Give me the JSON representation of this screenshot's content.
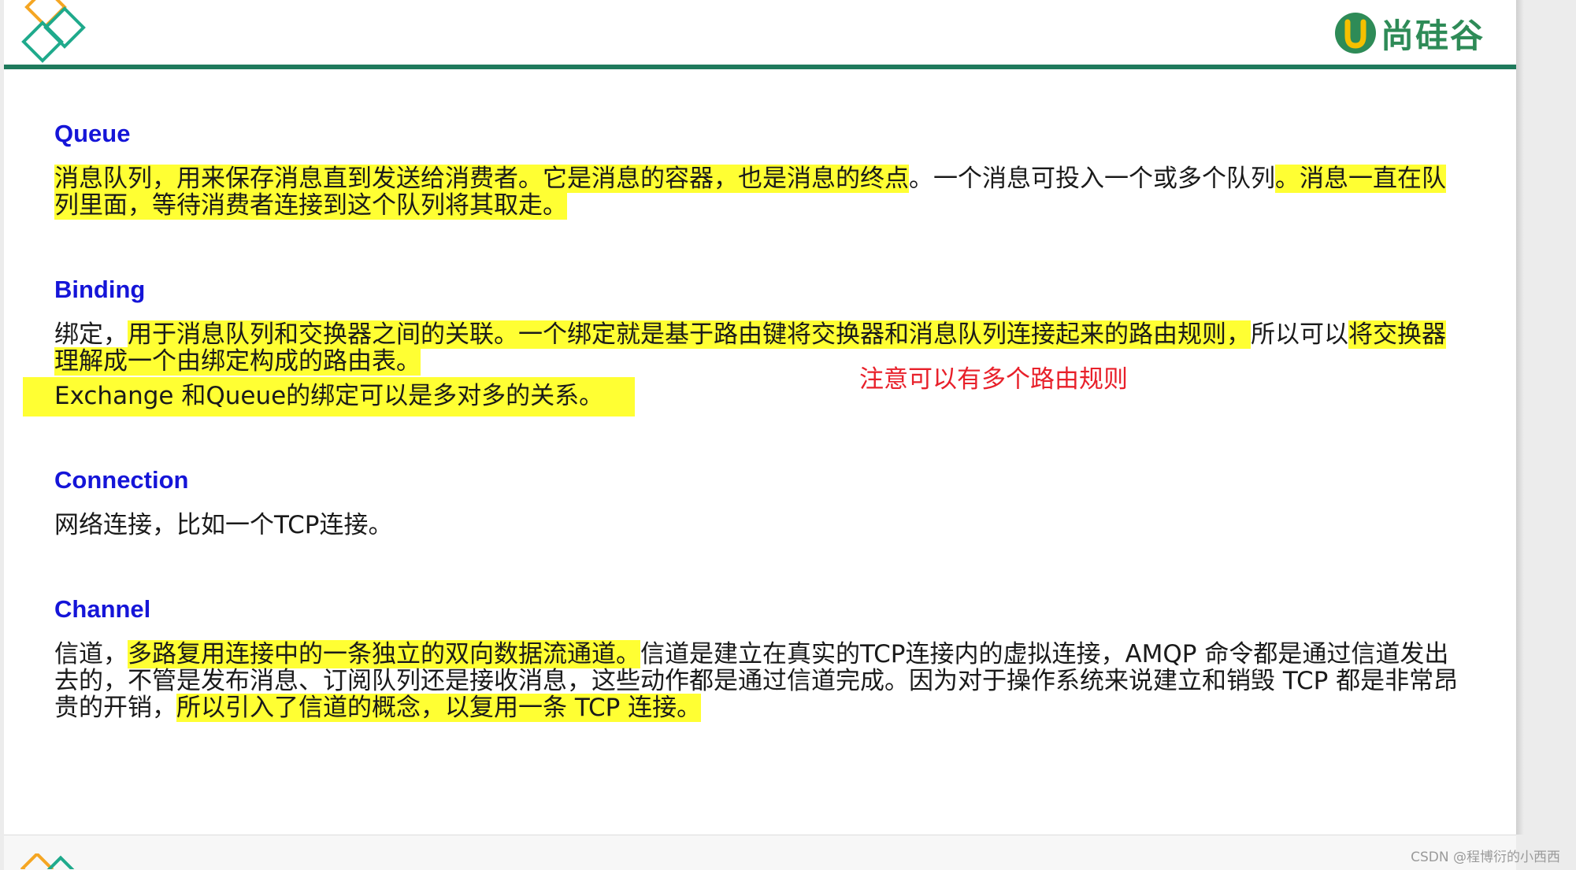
{
  "brand": {
    "name": "尚硅谷"
  },
  "sections": {
    "queue": {
      "heading": "Queue",
      "parts": [
        {
          "text": "消息队列，用来保存消息直到发送给消费者。它是消息的容器，也是消息的终点",
          "hl": true
        },
        {
          "text": "。一个消息可投入一个或多个队列",
          "hl": false
        },
        {
          "text": "。消息一直在队列里面，等待消费者连接到这个队列将其取走。",
          "hl": true
        }
      ]
    },
    "binding": {
      "heading": "Binding",
      "parts": [
        {
          "text": "绑定，",
          "hl": false
        },
        {
          "text": "用于消息队列和交换器之间的关联。一个绑定就是基于路由键将交换器和消息队列连接起来的路由规则，",
          "hl": true
        },
        {
          "text": "所以可以",
          "hl": false
        },
        {
          "text": "将交换器理解成一个由绑定构成的路由表。",
          "hl": true
        }
      ],
      "extra_line": "Exchange 和Queue的绑定可以是多对多的关系。",
      "note": "注意可以有多个路由规则"
    },
    "connection": {
      "heading": "Connection",
      "text": "网络连接，比如一个TCP连接。"
    },
    "channel": {
      "heading": "Channel",
      "parts": [
        {
          "text": "信道，",
          "hl": false
        },
        {
          "text": "多路复用连接中的一条独立的双向数据流通道。",
          "hl": true
        },
        {
          "text": "信道是建立在真实的TCP连接内的虚拟连接，AMQP 命令都是通过信道发出去的，不管是发布消息、订阅队列还是接收消息，这些动作都是通过信道完成。因为对于操作系统来说建立和销毁 TCP 都是非常昂贵的开销，",
          "hl": false
        },
        {
          "text": "所以引入了信道的概念，以复用一条 TCP 连接。",
          "hl": true
        }
      ]
    }
  },
  "watermark": "CSDN @程博衍的小西西",
  "colors": {
    "heading": "#1515d8",
    "highlight": "#ffff33",
    "note": "#e8202a",
    "rule": "#1f7a5c",
    "brand": "#2e8b57"
  }
}
